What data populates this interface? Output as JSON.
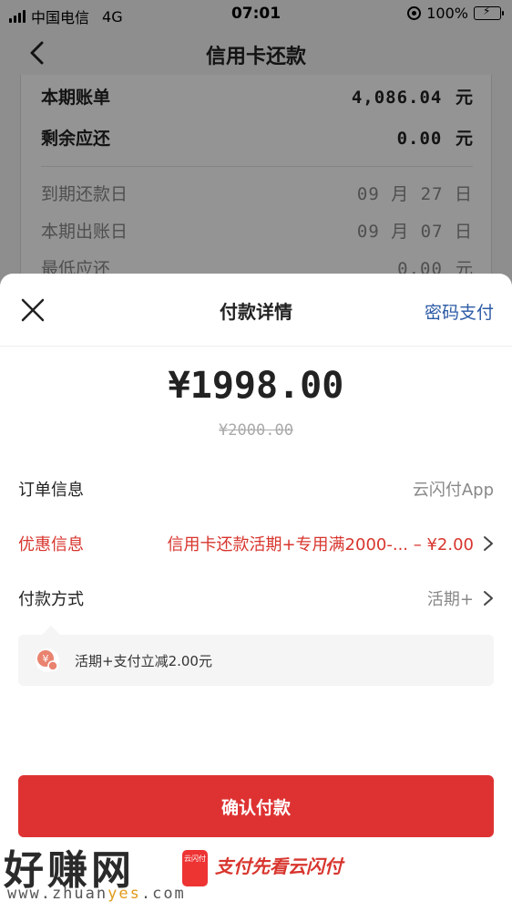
{
  "status_bar": {
    "carrier": "中国电信",
    "network": "4G",
    "time": "07:01",
    "battery": "100%"
  },
  "nav": {
    "title": "信用卡还款"
  },
  "bill": {
    "current_bill_label": "本期账单",
    "current_bill_value": "4,086.04",
    "remaining_label": "剩余应还",
    "remaining_value": "0.00",
    "unit": "元",
    "due_date_label": "到期还款日",
    "due_date_value": "09 月 27 日",
    "statement_date_label": "本期出账日",
    "statement_date_value": "09 月 07 日",
    "min_payment_label": "最低应还",
    "min_payment_value": "0.00"
  },
  "sheet": {
    "title": "付款详情",
    "password_pay": "密码支付",
    "amount": "¥1998.00",
    "original_amount": "¥2000.00",
    "order_label": "订单信息",
    "order_value": "云闪付App",
    "promo_label": "优惠信息",
    "promo_value": "信用卡还款活期+专用满2000-... – ¥2.00",
    "method_label": "付款方式",
    "method_value": "活期+",
    "tip_text": "活期+支付立减2.00元",
    "confirm": "确认付款"
  },
  "watermark": {
    "site_name": "好赚网",
    "url_prefix": "www.zhuan",
    "url_highlight": "yes",
    "url_suffix": ".com",
    "logo_text": "云闪付",
    "slogan": "支付先看云闪付"
  },
  "colors": {
    "accent_red": "#de3232",
    "link_blue": "#2c5aa6",
    "promo_red": "#d8352e"
  },
  "icons": [
    "signal-icon",
    "orientation-lock-icon",
    "battery-icon",
    "back-arrow-icon",
    "close-icon",
    "chevron-right-icon",
    "yuan-coin-icon"
  ]
}
